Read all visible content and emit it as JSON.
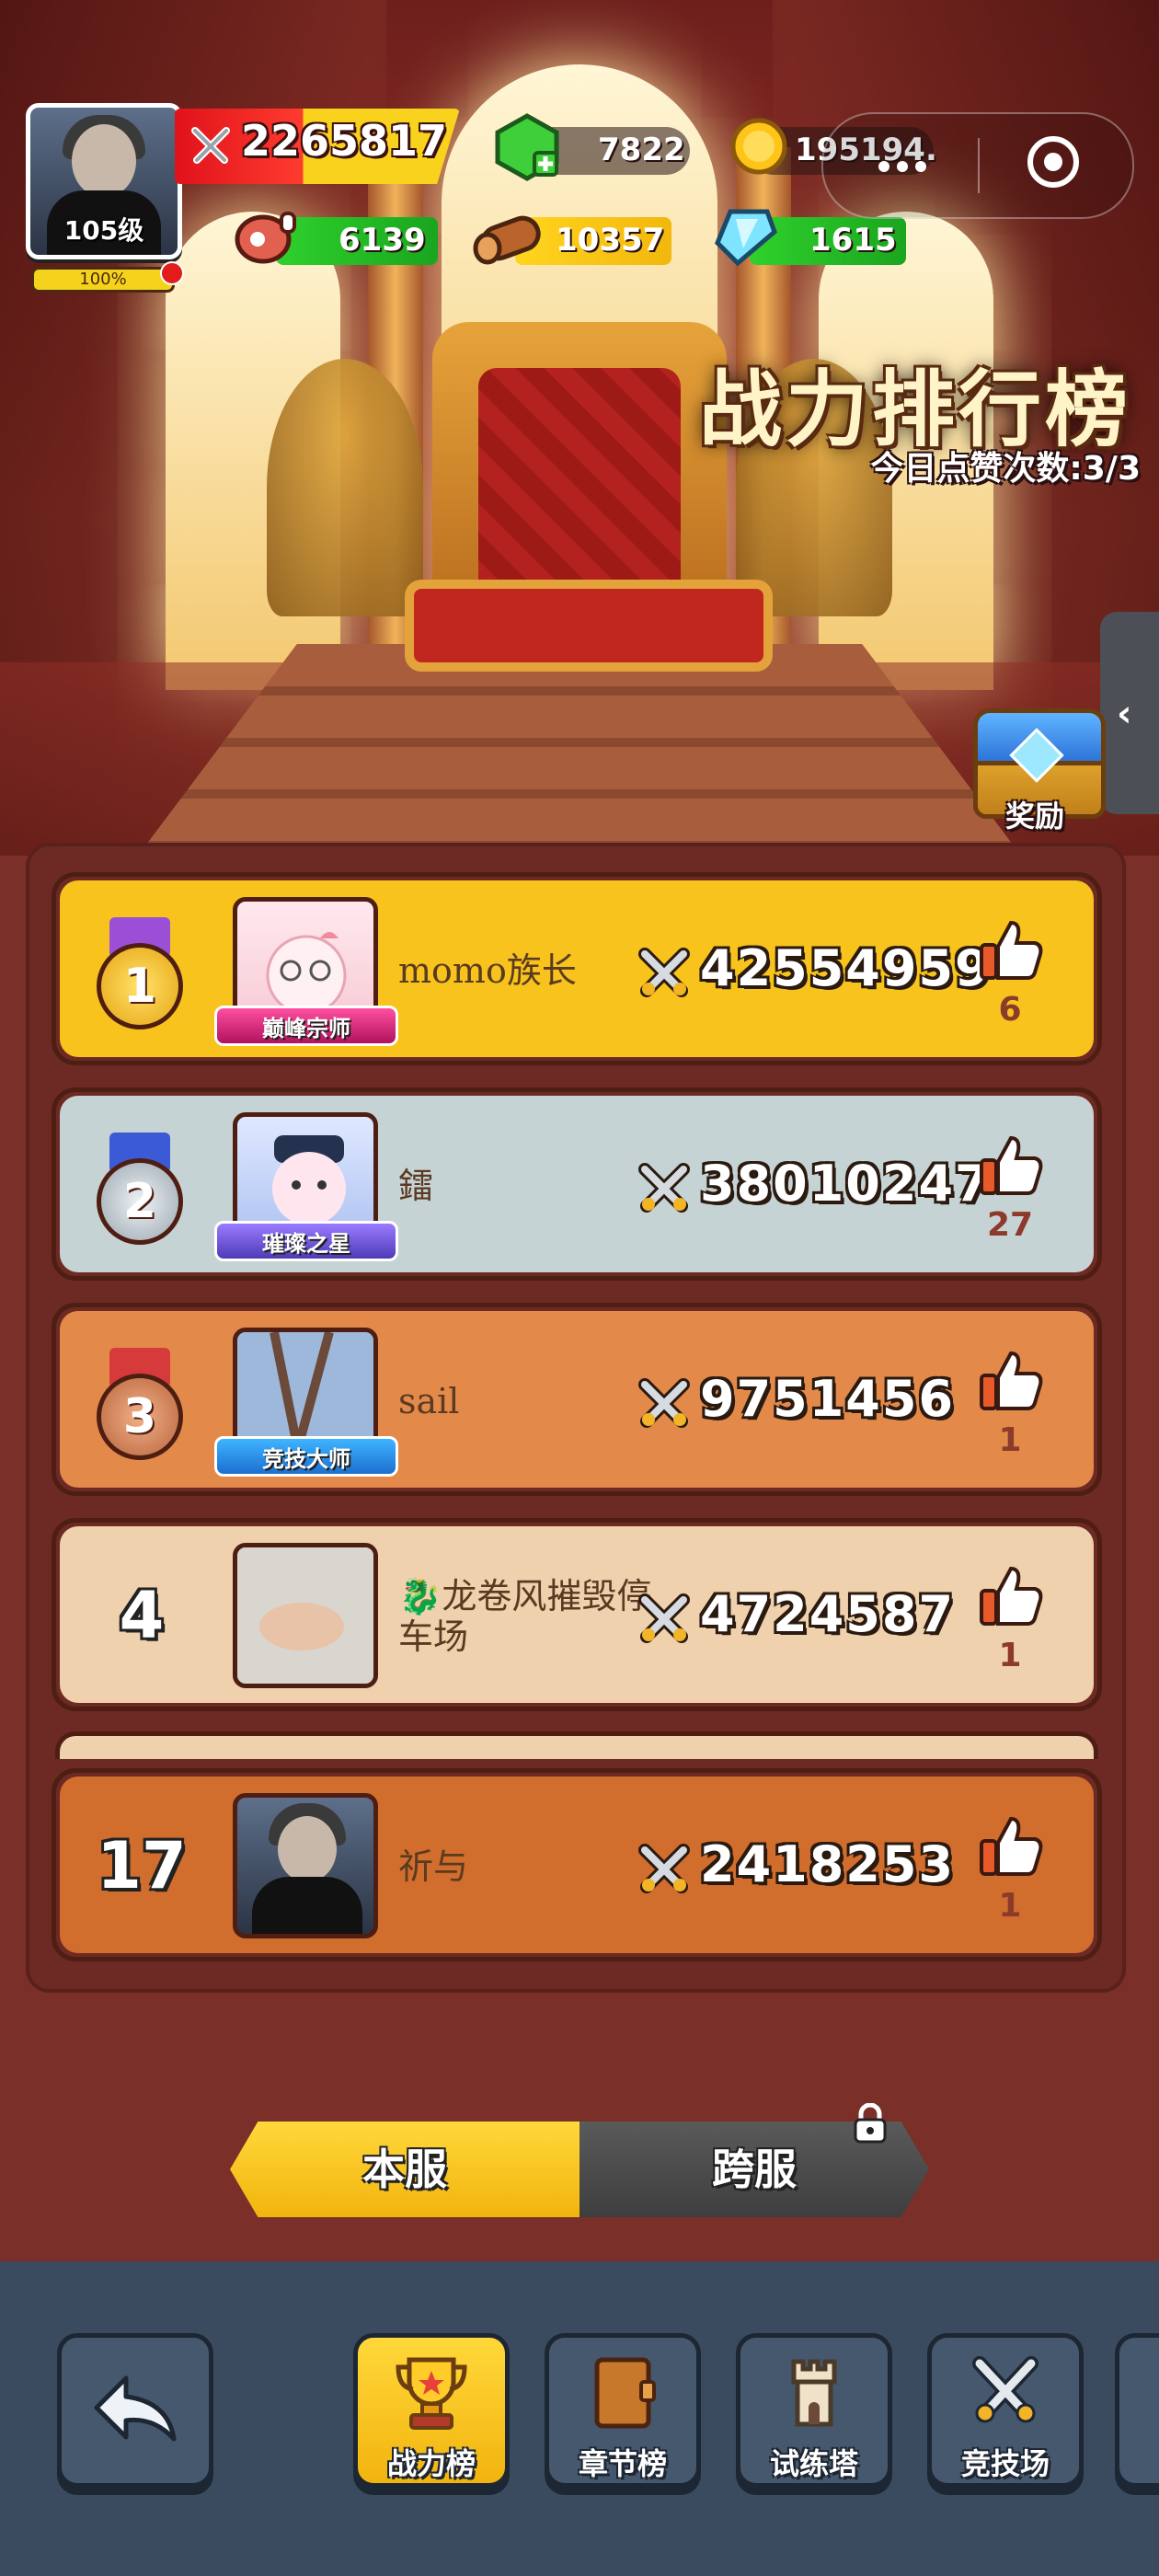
{
  "hud": {
    "level": "105级",
    "exp_percent": "100%",
    "power": "2265817",
    "gems": "7822",
    "gold": "195194.",
    "meat": "6139",
    "wood": "10357",
    "crystal": "1615"
  },
  "header": {
    "title": "战力排行榜",
    "likes_today": "今日点赞次数:3/3",
    "reward_label": "奖励"
  },
  "rankings": [
    {
      "rank": "1",
      "name": "momo族长",
      "badge": "巅峰宗师",
      "power": "42554959",
      "likes": "6"
    },
    {
      "rank": "2",
      "name": "鐳",
      "badge": "璀璨之星",
      "power": "38010247",
      "likes": "27"
    },
    {
      "rank": "3",
      "name": "sail",
      "badge": "竞技大师",
      "power": "9751456",
      "likes": "1"
    },
    {
      "rank": "4",
      "name": "🐉龙卷风摧毁停车场",
      "badge": "",
      "power": "4724587",
      "likes": "1"
    }
  ],
  "my_rank": {
    "rank": "17",
    "name": "祈与",
    "power": "2418253",
    "likes": "1"
  },
  "server_tabs": {
    "local": "本服",
    "cross": "跨服"
  },
  "bottom_nav": {
    "items": [
      "战力榜",
      "章节榜",
      "试练塔",
      "竞技场"
    ],
    "active": "战力榜"
  },
  "colors": {
    "gold_row": "#f7c31c",
    "silver_row": "#c6d3d4",
    "bronze_row": "#e38a4b",
    "cream_row": "#efd1ad",
    "self_row": "#d16d2d",
    "accent_yellow": "#ffd83a"
  }
}
